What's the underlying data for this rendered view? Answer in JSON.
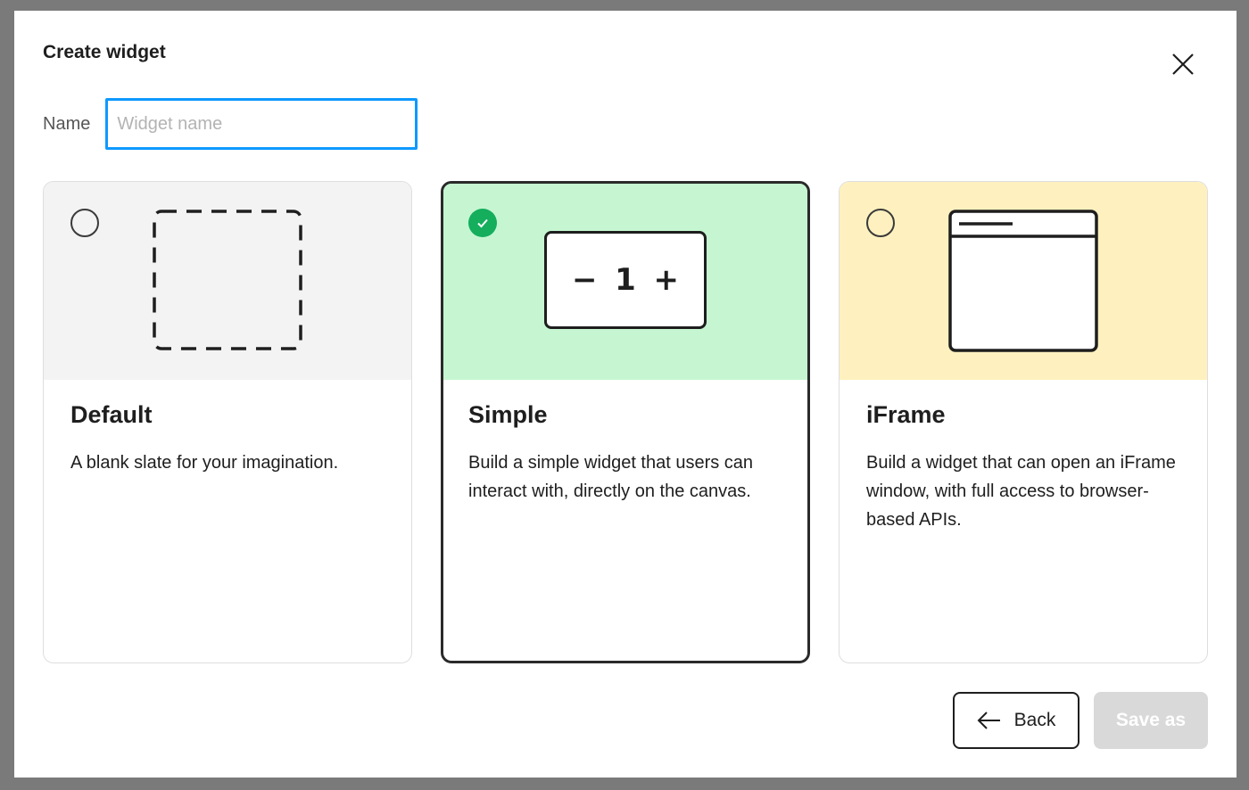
{
  "dialog": {
    "title": "Create widget"
  },
  "name_field": {
    "label": "Name",
    "value": "",
    "placeholder": "Widget name"
  },
  "cards": [
    {
      "title": "Default",
      "description": "A blank slate for your imagination.",
      "selected": false,
      "color": "#f3f3f3",
      "illustration": "dashed-square-icon"
    },
    {
      "title": "Simple",
      "description": "Build a simple widget that users can interact with, directly on the canvas.",
      "selected": true,
      "color": "#c5f6d1",
      "illustration": "counter-icon",
      "counter": {
        "minus": "−",
        "value": "1",
        "plus": "+"
      }
    },
    {
      "title": "iFrame",
      "description": "Build a widget that can open an iFrame window, with full access to browser-based APIs.",
      "selected": false,
      "color": "#fef1bf",
      "illustration": "browser-window-icon"
    }
  ],
  "footer": {
    "back_label": "Back",
    "save_label": "Save as",
    "save_disabled": true
  },
  "colors": {
    "accent": "#0d99ff",
    "success": "#14ae5c",
    "disabled": "#d9d9d9"
  }
}
